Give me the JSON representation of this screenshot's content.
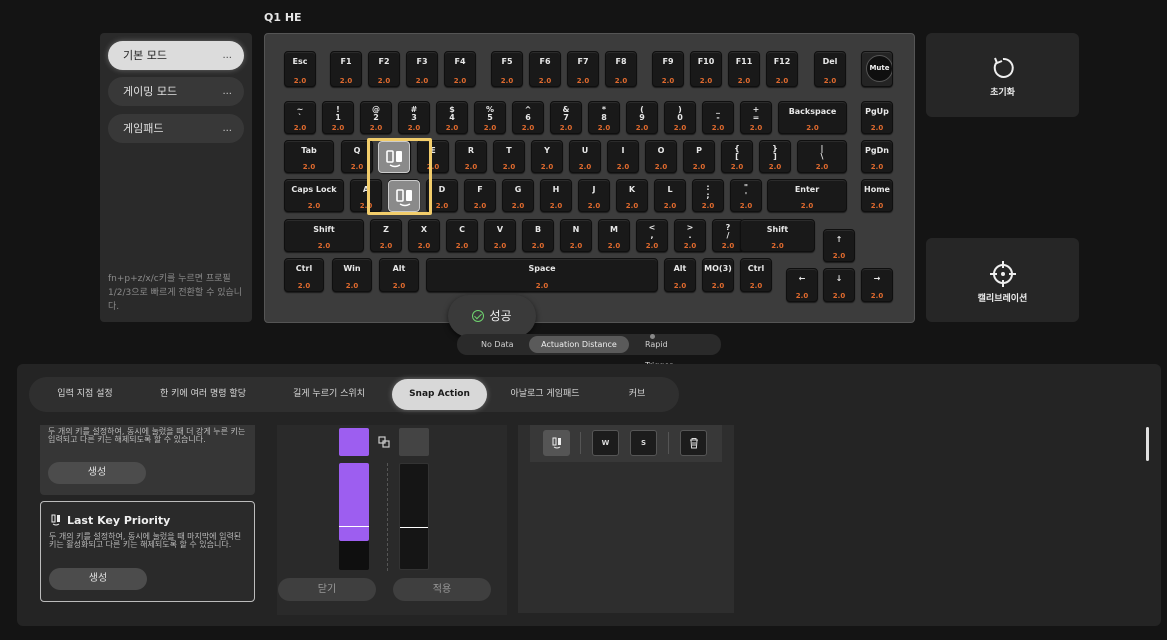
{
  "title": "Q1 HE",
  "sidebar": {
    "modes": [
      {
        "label": "기본 모드",
        "dots": "..."
      },
      {
        "label": "게이밍 모드",
        "dots": "..."
      },
      {
        "label": "게임패드",
        "dots": "..."
      }
    ],
    "hint": "fn+p+z/x/c키를 누르면 프로필 1/2/3으로 빠르게 전환할 수 있습니다."
  },
  "keys": [
    {
      "l": "Esc",
      "v": "2.0"
    },
    {
      "l": "F1",
      "v": "2.0"
    },
    {
      "l": "F2",
      "v": "2.0"
    },
    {
      "l": "F3",
      "v": "2.0"
    },
    {
      "l": "F4",
      "v": "2.0"
    },
    {
      "l": "F5",
      "v": "2.0"
    },
    {
      "l": "F6",
      "v": "2.0"
    },
    {
      "l": "F7",
      "v": "2.0"
    },
    {
      "l": "F8",
      "v": "2.0"
    },
    {
      "l": "F9",
      "v": "2.0"
    },
    {
      "l": "F10",
      "v": "2.0"
    },
    {
      "l": "F11",
      "v": "2.0"
    },
    {
      "l": "F12",
      "v": "2.0"
    },
    {
      "l": "Del",
      "v": "2.0"
    },
    {
      "l": "Mute",
      "v": ""
    },
    {
      "l": "~\n`",
      "v": "2.0"
    },
    {
      "l": "!\n1",
      "v": "2.0"
    },
    {
      "l": "@\n2",
      "v": "2.0"
    },
    {
      "l": "#\n3",
      "v": "2.0"
    },
    {
      "l": "$\n4",
      "v": "2.0"
    },
    {
      "l": "%\n5",
      "v": "2.0"
    },
    {
      "l": "^\n6",
      "v": "2.0"
    },
    {
      "l": "&\n7",
      "v": "2.0"
    },
    {
      "l": "*\n8",
      "v": "2.0"
    },
    {
      "l": "(\n9",
      "v": "2.0"
    },
    {
      "l": ")\n0",
      "v": "2.0"
    },
    {
      "l": "_\n-",
      "v": "2.0"
    },
    {
      "l": "+\n=",
      "v": "2.0"
    },
    {
      "l": "Backspace",
      "v": "2.0"
    },
    {
      "l": "PgUp",
      "v": "2.0"
    },
    {
      "l": "Tab",
      "v": "2.0"
    },
    {
      "l": "Q",
      "v": "2.0"
    },
    {
      "l": "",
      "v": ""
    },
    {
      "l": "E",
      "v": "2.0"
    },
    {
      "l": "R",
      "v": "2.0"
    },
    {
      "l": "T",
      "v": "2.0"
    },
    {
      "l": "Y",
      "v": "2.0"
    },
    {
      "l": "U",
      "v": "2.0"
    },
    {
      "l": "I",
      "v": "2.0"
    },
    {
      "l": "O",
      "v": "2.0"
    },
    {
      "l": "P",
      "v": "2.0"
    },
    {
      "l": "{\n[",
      "v": "2.0"
    },
    {
      "l": "}\n]",
      "v": "2.0"
    },
    {
      "l": "|\n\\",
      "v": "2.0"
    },
    {
      "l": "PgDn",
      "v": "2.0"
    },
    {
      "l": "Caps Lock",
      "v": "2.0"
    },
    {
      "l": "A",
      "v": "2.0"
    },
    {
      "l": "",
      "v": ""
    },
    {
      "l": "D",
      "v": "2.0"
    },
    {
      "l": "F",
      "v": "2.0"
    },
    {
      "l": "G",
      "v": "2.0"
    },
    {
      "l": "H",
      "v": "2.0"
    },
    {
      "l": "J",
      "v": "2.0"
    },
    {
      "l": "K",
      "v": "2.0"
    },
    {
      "l": "L",
      "v": "2.0"
    },
    {
      "l": ":\n;",
      "v": "2.0"
    },
    {
      "l": "\"\n'",
      "v": "2.0"
    },
    {
      "l": "Enter",
      "v": "2.0"
    },
    {
      "l": "Home",
      "v": "2.0"
    },
    {
      "l": "Shift",
      "v": "2.0"
    },
    {
      "l": "Z",
      "v": "2.0"
    },
    {
      "l": "X",
      "v": "2.0"
    },
    {
      "l": "C",
      "v": "2.0"
    },
    {
      "l": "V",
      "v": "2.0"
    },
    {
      "l": "B",
      "v": "2.0"
    },
    {
      "l": "N",
      "v": "2.0"
    },
    {
      "l": "M",
      "v": "2.0"
    },
    {
      "l": "<\n,",
      "v": "2.0"
    },
    {
      "l": ">\n.",
      "v": "2.0"
    },
    {
      "l": "?\n/",
      "v": "2.0"
    },
    {
      "l": "Shift",
      "v": "2.0"
    },
    {
      "l": "↑",
      "v": "2.0"
    },
    {
      "l": "Ctrl",
      "v": "2.0"
    },
    {
      "l": "Win",
      "v": "2.0"
    },
    {
      "l": "Alt",
      "v": "2.0"
    },
    {
      "l": "Space",
      "v": "2.0"
    },
    {
      "l": "Alt",
      "v": "2.0"
    },
    {
      "l": "MO(3)",
      "v": "2.0"
    },
    {
      "l": "Ctrl",
      "v": "2.0"
    },
    {
      "l": "←",
      "v": "2.0"
    },
    {
      "l": "↓",
      "v": "2.0"
    },
    {
      "l": "→",
      "v": "2.0"
    }
  ],
  "success": "성공",
  "modebar": {
    "items": [
      "No Data",
      "Actuation Distance",
      "Rapid Trigger"
    ]
  },
  "right_cards": {
    "reset": "초기화",
    "calibration": "캘리브레이션"
  },
  "tabs": [
    "입력 지점 설정",
    "한 키에 여러 명령 할당",
    "길게 누르기 스위치",
    "Snap Action",
    "아날로그 게임패드",
    "커브"
  ],
  "cards": [
    {
      "desc": "두 개의 키를 설정하여, 동시에 눌렀을 때 더 강게 누른 키는 입력되고 다른 키는 해제되도록 할 수 있습니다.",
      "button": "생성"
    },
    {
      "title": "Last Key Priority",
      "desc": "두 개의 키를 설정하여, 동시에 눌렀을 때 마지막에 입력된 키는 활성화되고 다른 키는 해제되도록 할 수 있습니다.",
      "button": "생성"
    }
  ],
  "mid": {
    "close": "닫기",
    "apply": "적용"
  },
  "snap_keys": [
    "W",
    "S"
  ],
  "colors": {
    "accent": "#9d5ef0",
    "value": "#e06a2e",
    "highlight": "#f2cd6b",
    "success": "#6fd36f"
  }
}
